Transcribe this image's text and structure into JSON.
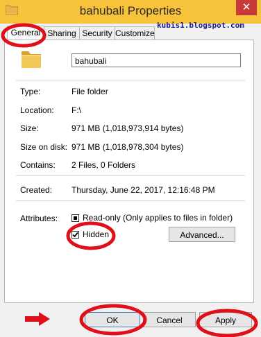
{
  "window": {
    "title": "bahubali Properties",
    "close_symbol": "✕"
  },
  "watermark": "kubis1.blogspot.com",
  "tabs": [
    {
      "label": "General",
      "active": true
    },
    {
      "label": "Sharing",
      "active": false
    },
    {
      "label": "Security",
      "active": false
    },
    {
      "label": "Customize",
      "active": false
    }
  ],
  "general": {
    "name": "bahubali",
    "rows": [
      {
        "label": "Type:",
        "value": "File folder"
      },
      {
        "label": "Location:",
        "value": "F:\\"
      },
      {
        "label": "Size:",
        "value": "971 MB (1,018,973,914 bytes)"
      },
      {
        "label": "Size on disk:",
        "value": "971 MB (1,018,978,304 bytes)"
      },
      {
        "label": "Contains:",
        "value": "2 Files, 0 Folders"
      }
    ],
    "created_label": "Created:",
    "created_value": "Thursday, June 22, 2017, 12:16:48 PM",
    "attributes_label": "Attributes:",
    "readonly_label": "Read-only (Only applies to files in folder)",
    "readonly_state": "indeterminate",
    "hidden_label": "Hidden",
    "hidden_checked": true,
    "advanced_label": "Advanced..."
  },
  "buttons": {
    "ok": "OK",
    "cancel": "Cancel",
    "apply": "Apply"
  },
  "colors": {
    "titlebar": "#f7c33b",
    "close": "#c93a3a",
    "annotation": "#e0101a"
  },
  "icons": [
    "folder-icon",
    "close-icon",
    "arrow-right-icon"
  ]
}
